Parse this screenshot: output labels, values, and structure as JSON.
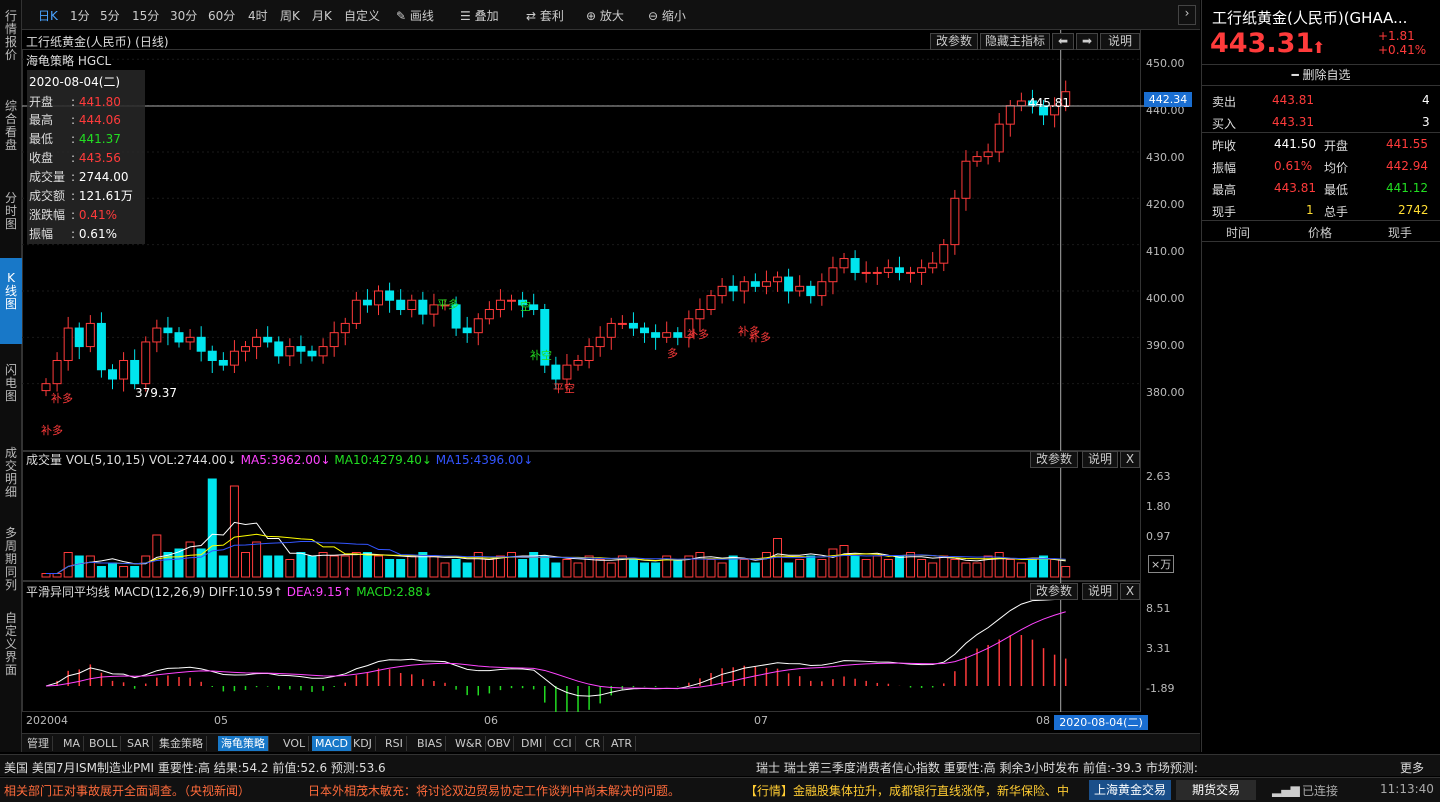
{
  "sidebar": [
    "行情报价",
    "综合看盘",
    "分时图",
    "K线图",
    "闪电图",
    "成交明细",
    "多周期同列",
    "自定义界面"
  ],
  "toolbar": {
    "items": [
      "日K",
      "1分",
      "5分",
      "15分",
      "30分",
      "60分",
      "4时",
      "周K",
      "月K",
      "自定义",
      "画线",
      "叠加",
      "套利",
      "放大",
      "缩小"
    ],
    "active": "日K"
  },
  "chart": {
    "title": "工行纸黄金(人民币) (日线)",
    "strategy": "海龟策略 HGCL",
    "buttons": {
      "params": "改参数",
      "hide": "隐藏主指标",
      "help": "说明",
      "close": "X"
    },
    "price_axis": [
      "450.00",
      "440.00",
      "430.00",
      "420.00",
      "410.00",
      "400.00",
      "390.00",
      "380.00"
    ],
    "cursor_price": "442.34",
    "high_label": "445.81",
    "low_label": "379.37",
    "signals": {
      "bu_duo": "补多",
      "ping_duo": "平多",
      "kong": "空",
      "bu_kong": "补空",
      "ping_kong": "平空",
      "duo": "多"
    },
    "info": {
      "date": "2020-08-04(二)",
      "rows": [
        {
          "k": "开盘",
          "v": "441.80",
          "c": "red"
        },
        {
          "k": "最高",
          "v": "444.06",
          "c": "red"
        },
        {
          "k": "最低",
          "v": "441.37",
          "c": "green"
        },
        {
          "k": "收盘",
          "v": "443.56",
          "c": "red"
        },
        {
          "k": "成交量",
          "v": "2744.00",
          "c": "white"
        },
        {
          "k": "成交额",
          "v": "121.61万",
          "c": "white"
        },
        {
          "k": "涨跌幅",
          "v": "0.41%",
          "c": "red"
        },
        {
          "k": "振幅",
          "v": "0.61%",
          "c": "white"
        }
      ]
    },
    "vol": {
      "title": "成交量 VOL(5,10,15)",
      "vol": "VOL:2744.00↓",
      "ma5": "MA5:3962.00↓",
      "ma10": "MA10:4279.40↓",
      "ma15": "MA15:4396.00↓",
      "axis": [
        "2.63",
        "1.80",
        "0.97"
      ],
      "unit": "×万"
    },
    "macd": {
      "title": "平滑异同平均线 MACD(12,26,9)",
      "diff": "DIFF:10.59↑",
      "dea": "DEA:9.15↑",
      "macd": "MACD:2.88↓",
      "axis": [
        "8.51",
        "3.31",
        "-1.89"
      ]
    },
    "date_axis": [
      "202004",
      "05",
      "06",
      "07",
      "08"
    ],
    "cursor_date": "2020-08-04(二)",
    "colors": {
      "up": "#ff3b3b",
      "down": "#00e5ee",
      "ma5": "#ffffff",
      "ma10": "#ffff00",
      "ma15": "#ff44ff",
      "bg": "#000000"
    }
  },
  "chart_data": {
    "type": "candlestick",
    "ylim": [
      370,
      452
    ],
    "closes": [
      380,
      385,
      392,
      388,
      393,
      383,
      381,
      385,
      380,
      389,
      392,
      391,
      389,
      390,
      387,
      385,
      384,
      387,
      388,
      390,
      389,
      386,
      388,
      387,
      386,
      388,
      391,
      393,
      398,
      397,
      400,
      398,
      396,
      398,
      395,
      397,
      397,
      392,
      391,
      394,
      396,
      398,
      398,
      397,
      396,
      384,
      381,
      384,
      385,
      388,
      390,
      393,
      393,
      392,
      391,
      390,
      391,
      390,
      394,
      396,
      399,
      401,
      400,
      402,
      401,
      402,
      403,
      400,
      401,
      399,
      402,
      405,
      407,
      404,
      404,
      404,
      405,
      404,
      404,
      405,
      406,
      410,
      420,
      428,
      429,
      430,
      436,
      440,
      441,
      440,
      438,
      440,
      443
    ],
    "vol_ylim": [
      0,
      3.2
    ],
    "vols": [
      0.1,
      0.1,
      0.7,
      0.6,
      0.6,
      0.3,
      0.4,
      0.3,
      0.3,
      0.6,
      1.2,
      0.7,
      0.8,
      1.0,
      0.8,
      2.8,
      0.6,
      2.6,
      0.7,
      1.0,
      0.6,
      0.6,
      0.5,
      0.7,
      0.6,
      0.7,
      0.6,
      0.6,
      0.7,
      0.7,
      0.6,
      0.5,
      0.5,
      0.6,
      0.7,
      0.6,
      0.4,
      0.5,
      0.4,
      0.7,
      0.5,
      0.6,
      0.7,
      0.5,
      0.7,
      0.6,
      0.4,
      0.5,
      0.4,
      0.6,
      0.5,
      0.4,
      0.6,
      0.5,
      0.4,
      0.4,
      0.6,
      0.5,
      0.6,
      0.7,
      0.5,
      0.4,
      0.6,
      0.5,
      0.4,
      0.7,
      1.1,
      0.4,
      0.5,
      0.6,
      0.5,
      0.8,
      0.9,
      0.6,
      0.5,
      0.6,
      0.5,
      0.6,
      0.7,
      0.5,
      0.4,
      0.6,
      0.5,
      0.4,
      0.4,
      0.6,
      0.7,
      0.5,
      0.4,
      0.5,
      0.6,
      0.5,
      0.3
    ],
    "macd_ylim": [
      -3,
      11
    ]
  },
  "quote": {
    "name": "工行纸黄金(人民币)(GHAA...",
    "price": "443.31",
    "arrow": "⬆",
    "change": "+1.81",
    "pct": "+0.41%",
    "remove": "━ 删除自选",
    "sell": {
      "label": "卖出",
      "price": "443.81",
      "qty": "4"
    },
    "buy": {
      "label": "买入",
      "price": "443.31",
      "qty": "3"
    },
    "stats": [
      {
        "k1": "昨收",
        "v1": "441.50",
        "c1": "white",
        "k2": "开盘",
        "v2": "441.55",
        "c2": "red"
      },
      {
        "k1": "振幅",
        "v1": "0.61%",
        "c1": "red",
        "k2": "均价",
        "v2": "442.94",
        "c2": "red"
      },
      {
        "k1": "最高",
        "v1": "443.81",
        "c1": "red",
        "k2": "最低",
        "v2": "441.12",
        "c2": "green"
      },
      {
        "k1": "现手",
        "v1": "1",
        "c1": "yellow",
        "k2": "总手",
        "v2": "2742",
        "c2": "yellow"
      }
    ],
    "cols": [
      "时间",
      "价格",
      "现手"
    ]
  },
  "bottom_tabs": {
    "items": [
      "管理",
      "MA",
      "BOLL",
      "SAR",
      "集金策略",
      "海龟策略",
      "VOL",
      "MACD",
      "KDJ",
      "RSI",
      "BIAS",
      "W&R",
      "OBV",
      "DMI",
      "CCI",
      "CR",
      "ATR"
    ],
    "active": [
      "海龟策略",
      "MACD"
    ]
  },
  "ticker1": {
    "left": "美国  美国7月ISM制造业PMI  重要性:高  结果:54.2  前值:52.6  预测:53.6",
    "right": "瑞士  瑞士第三季度消费者信心指数  重要性:高  剩余3小时发布  前值:-39.3  市场预测:",
    "more": "更多"
  },
  "ticker2": {
    "news1": "相关部门正对事故展开全面调查。（央视新闻）",
    "news2": "日本外相茂木敏充：将讨论双边贸易协定工作谈判中尚未解决的问题。",
    "news3": "【行情】金融股集体拉升，成都银行直线涨停，新华保险、中",
    "tab1": "上海黄金交易",
    "tab2": "期货交易",
    "status": "已连接",
    "time": "11:13:40"
  }
}
